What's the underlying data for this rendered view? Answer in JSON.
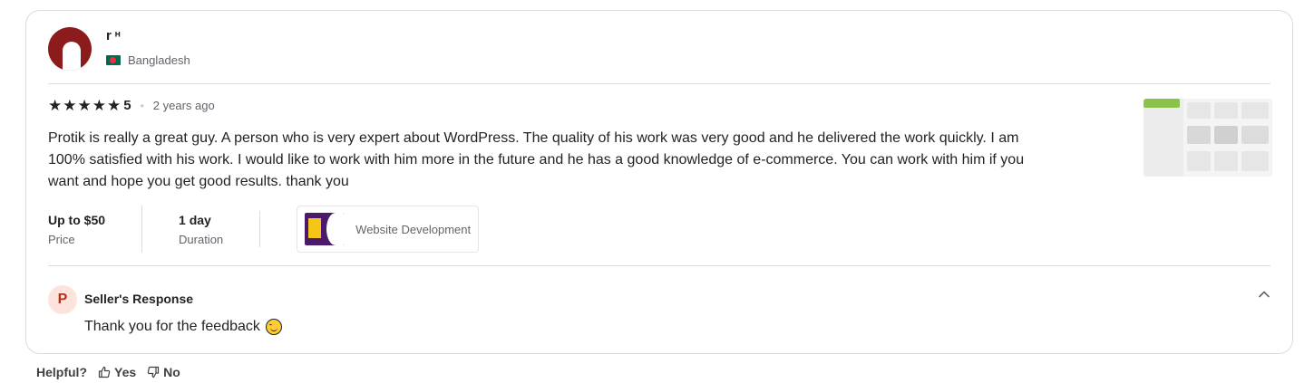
{
  "reviewer": {
    "name": "r     ᵸ",
    "country": "Bangladesh"
  },
  "review": {
    "rating": "5",
    "stars_count": 5,
    "time_ago": "2 years ago",
    "text": "Protik is really a great guy. A person who is very expert about WordPress. The quality of his work was very good and he delivered the work quickly. I am 100% satisfied with his work. I would like to work with him more in the future and he has a good knowledge of e-commerce. You can work with him if you want and hope you get good results. thank you"
  },
  "meta": {
    "price_value": "Up to $50",
    "price_label": "Price",
    "duration_value": "1 day",
    "duration_label": "Duration",
    "gig_label": "Website Development"
  },
  "seller_response": {
    "initial": "P",
    "title": "Seller's Response",
    "text": "Thank you for the feedback"
  },
  "helpful": {
    "label": "Helpful?",
    "yes": "Yes",
    "no": "No"
  },
  "icons": {
    "star": "star-icon",
    "thumbs_up": "thumbs-up-icon",
    "thumbs_down": "thumbs-down-icon",
    "chevron": "chevron-up-icon",
    "emoji": "smiling-face-emoji"
  },
  "colors": {
    "avatar": "#8c1c1c",
    "seller_avatar_bg": "#fde3dc",
    "text": "#222325",
    "muted": "#62646a"
  }
}
